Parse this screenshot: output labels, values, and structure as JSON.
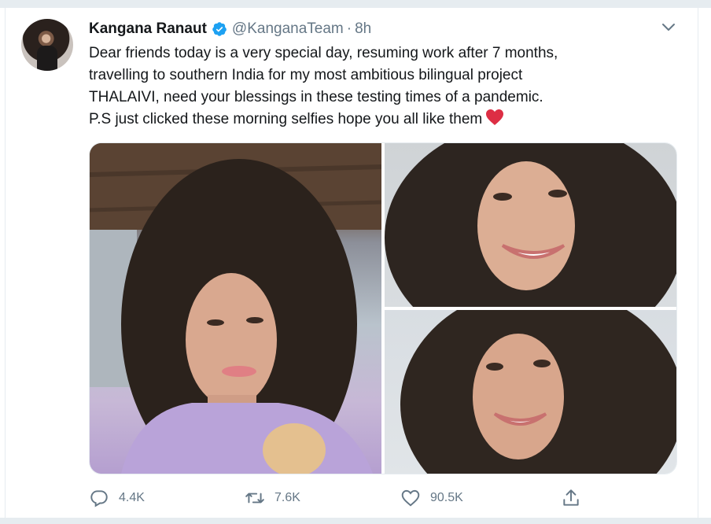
{
  "tweet": {
    "author_name": "Kangana Ranaut",
    "handle": "@KanganaTeam",
    "separator": "·",
    "time": "8h",
    "text_lines": [
      "Dear friends today is a very special day, resuming work after 7 months,",
      "travelling to southern India for my most ambitious bilingual project",
      "THALAIVI, need your blessings in these testing times of a pandemic.",
      "P.S just clicked these morning selfies hope you all like them"
    ],
    "replies": "4.4K",
    "retweets": "7.6K",
    "likes": "90.5K"
  },
  "icons": {
    "verified": "verified-badge-icon",
    "more": "chevron-down-icon",
    "reply": "reply-icon",
    "retweet": "retweet-icon",
    "like": "heart-icon",
    "share": "share-icon",
    "emoji": "red-heart-emoji"
  },
  "colors": {
    "verified_blue": "#1da1f2",
    "text": "#14171a",
    "muted": "#657786",
    "heart_red": "#e0245e"
  }
}
